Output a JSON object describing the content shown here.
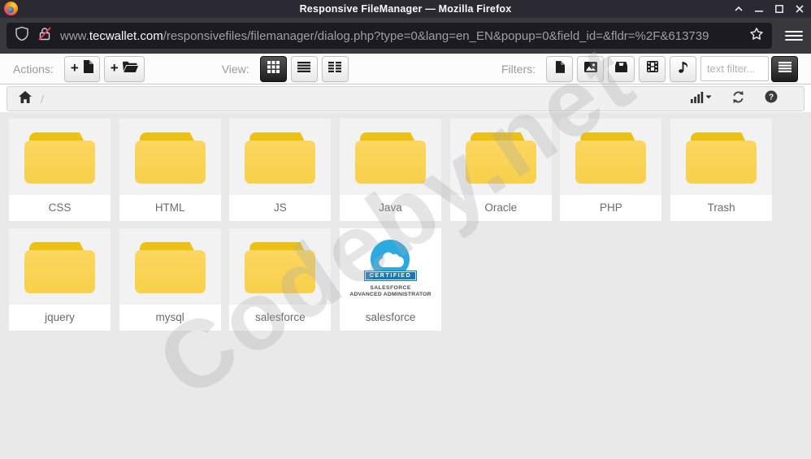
{
  "window": {
    "title": "Responsive FileManager — Mozilla Firefox"
  },
  "browser": {
    "url_prefix": "www.",
    "url_domain": "tecwallet.com",
    "url_path": "/responsivefiles/filemanager/dialog.php?type=0&lang=en_EN&popup=0&field_id=&fldr=%2F&613739"
  },
  "toolbar": {
    "actions_label": "Actions:",
    "view_label": "View:",
    "filters_label": "Filters:",
    "text_filter_placeholder": "text filter..."
  },
  "pathbar": {
    "separator": "/"
  },
  "files": {
    "folders": [
      "CSS",
      "HTML",
      "JS",
      "Java",
      "Oracle",
      "PHP",
      "Trash",
      "jquery",
      "mysql",
      "salesforce"
    ],
    "image": {
      "name": "salesforce",
      "badge_ribbon": "CERTIFIED",
      "badge_line1": "SALESFORCE",
      "badge_line2": "ADVANCED ADMINISTRATOR"
    }
  },
  "watermark": {
    "text": "Codeby.net"
  },
  "colors": {
    "titlebar_bg": "#2B2A33",
    "navbar_bg": "#38383D",
    "urlfield_bg": "#1C1B22",
    "toolbar_bg": "#FCFCFC",
    "pathbar_bg": "#F0F0F0",
    "content_bg": "#E9E9E9",
    "folder_tab": "#ECC115",
    "folder_body": "#FBD55C",
    "badge_blue": "#2BA9E1",
    "ribbon_blue": "#1878BC",
    "insecure_slash_red": "#FF3B5C"
  }
}
